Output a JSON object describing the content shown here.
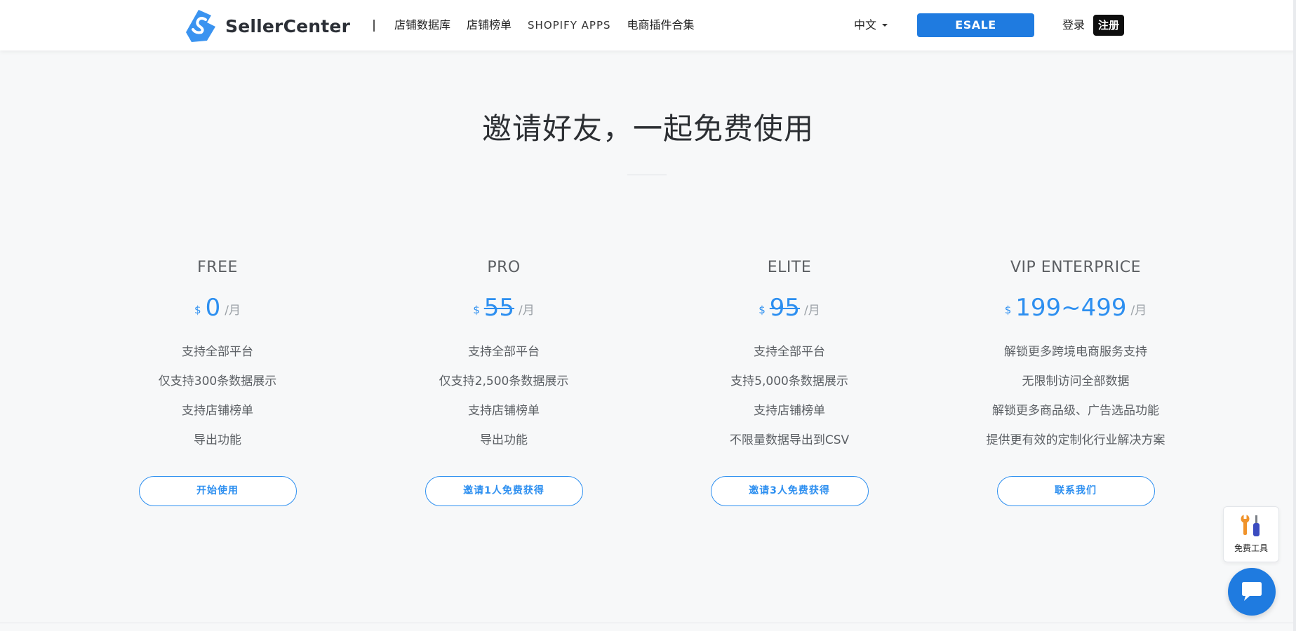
{
  "header": {
    "logo_text": "SellerCenter",
    "nav": [
      "店铺数据库",
      "店铺榜单",
      "SHOPIFY APPS",
      "电商插件合集"
    ],
    "lang": "中文",
    "esale_label": "ESALE",
    "login_label": "登录",
    "register_label": "注册"
  },
  "main": {
    "headline": "邀请好友，一起免费使用"
  },
  "plans": [
    {
      "name": "FREE",
      "currency": "$",
      "amount": "0",
      "per": "/月",
      "features": [
        "支持全部平台",
        "仅支持300条数据展示",
        "支持店铺榜单",
        "导出功能"
      ],
      "cta": "开始使用"
    },
    {
      "name": "PRO",
      "currency": "$",
      "amount": "55",
      "per": "/月",
      "features": [
        "支持全部平台",
        "仅支持2,500条数据展示",
        "支持店铺榜单",
        "导出功能"
      ],
      "cta": "邀请1人免费获得"
    },
    {
      "name": "ELITE",
      "currency": "$",
      "amount": "95",
      "per": "/月",
      "features": [
        "支持全部平台",
        "支持5,000条数据展示",
        "支持店铺榜单",
        "不限量数据导出到CSV"
      ],
      "cta": "邀请3人免费获得"
    },
    {
      "name": "VIP ENTERPRICE",
      "currency": "$",
      "amount": "199~499",
      "per": "/月",
      "features": [
        "解锁更多跨境电商服务支持",
        "无限制访问全部数据",
        "解锁更多商品级、广告选品功能",
        "提供更有效的定制化行业解决方案"
      ],
      "cta": "联系我们"
    }
  ],
  "widgets": {
    "tools_label": "免费工具",
    "tools_icon": "wrench-screwdriver-icon",
    "chat_icon": "chat-bubble-icon"
  },
  "colors": {
    "accent": "#1f7be0",
    "price": "#2d8ff0",
    "register_bg": "#0e0e0e"
  }
}
